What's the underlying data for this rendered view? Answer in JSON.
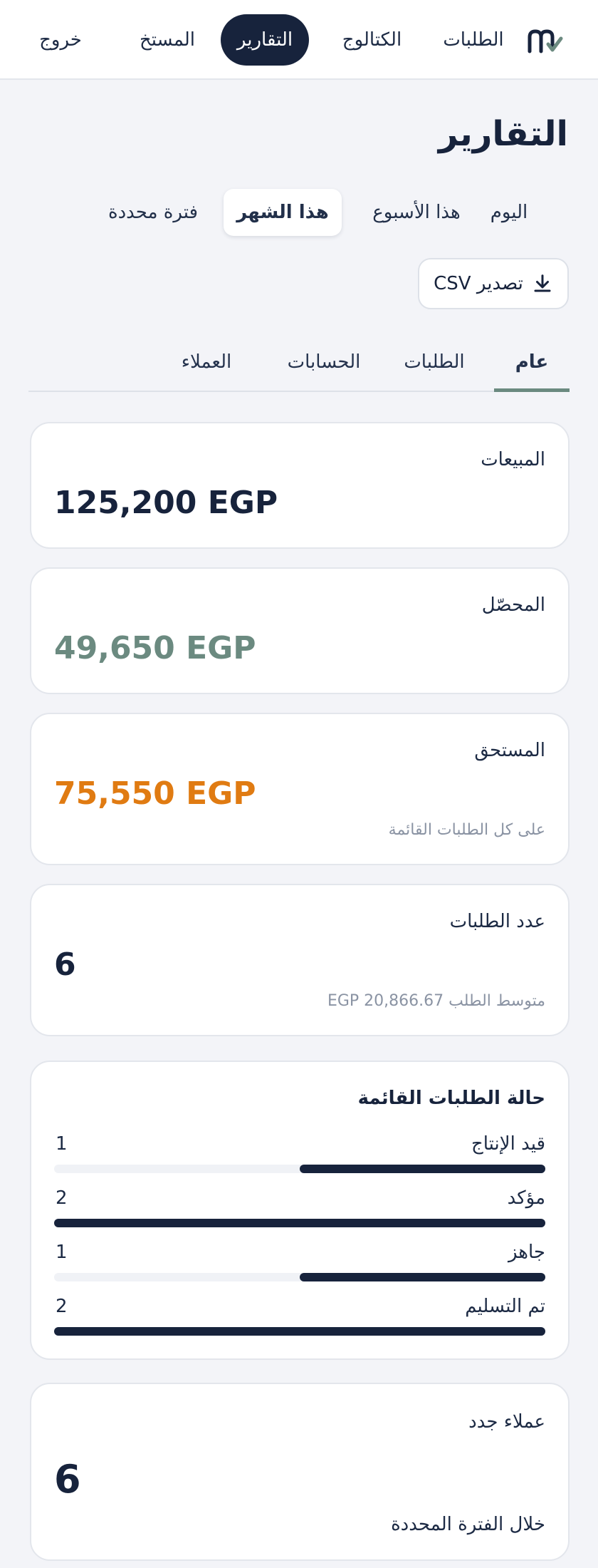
{
  "nav": {
    "items": [
      {
        "label": "الطلبات",
        "active": false
      },
      {
        "label": "الكتالوج",
        "active": false
      },
      {
        "label": "التقارير",
        "active": true
      },
      {
        "label": "المستخ",
        "active": false
      },
      {
        "label": "خروج",
        "active": false
      }
    ],
    "logo_icon": "brand-m-check-icon"
  },
  "page": {
    "title": "التقارير"
  },
  "periods": [
    {
      "label": "اليوم",
      "active": false
    },
    {
      "label": "هذا الأسبوع",
      "active": false
    },
    {
      "label": "هذا الشهر",
      "active": true
    },
    {
      "label": "فترة محددة",
      "active": false
    }
  ],
  "export": {
    "label": "تصدير CSV",
    "icon": "download-icon"
  },
  "tabs": [
    {
      "label": "عام",
      "active": true
    },
    {
      "label": "الطلبات",
      "active": false
    },
    {
      "label": "الحسابات",
      "active": false
    },
    {
      "label": "العملاء",
      "active": false
    }
  ],
  "cards": {
    "sales": {
      "label": "المبيعات",
      "value": "125,200 EGP",
      "color": "#17233c"
    },
    "collected": {
      "label": "المحصّل",
      "value": "49,650 EGP",
      "color": "#6b8a80"
    },
    "due": {
      "label": "المستحق",
      "value": "75,550 EGP",
      "note": "على كل الطلبات القائمة",
      "color": "#e07b12"
    },
    "orders": {
      "label": "عدد الطلبات",
      "value": "6",
      "note": "متوسط الطلب EGP 20,866.67"
    },
    "status": {
      "title": "حالة الطلبات القائمة",
      "max": 2,
      "rows": [
        {
          "name": "قيد الإنتاج",
          "count": 1
        },
        {
          "name": "مؤكد",
          "count": 2
        },
        {
          "name": "جاهز",
          "count": 1
        },
        {
          "name": "تم التسليم",
          "count": 2
        }
      ]
    },
    "new_customers": {
      "label": "عملاء جدد",
      "value": "6",
      "note": "خلال الفترة المحددة"
    }
  }
}
